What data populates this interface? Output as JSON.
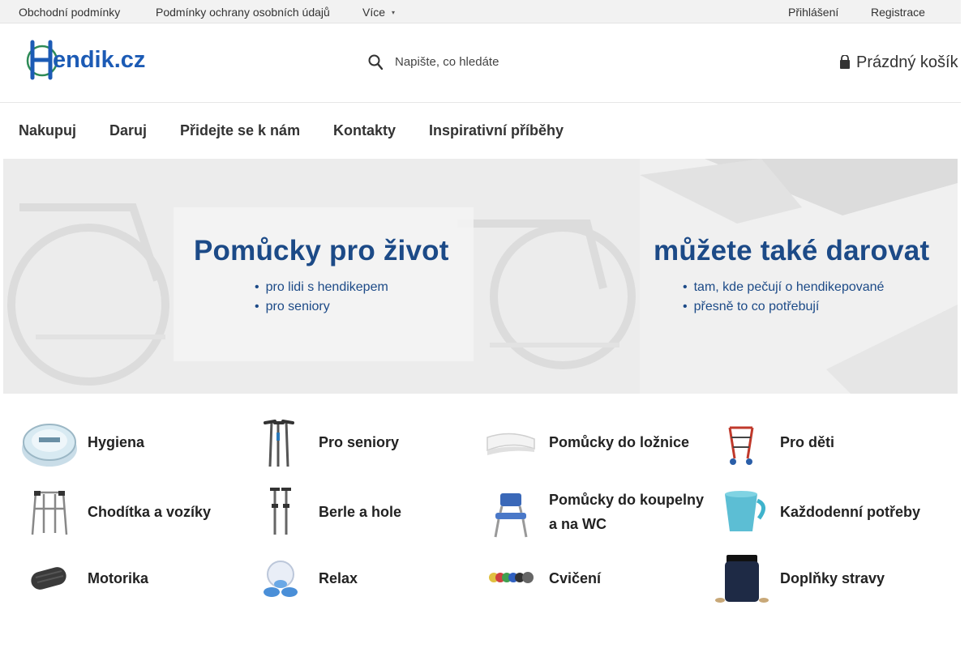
{
  "topbar": {
    "links": [
      "Obchodní podmínky",
      "Podmínky ochrany osobních údajů",
      "Více"
    ],
    "login": "Přihlášení",
    "register": "Registrace"
  },
  "header": {
    "logo_text": "Hendik.cz",
    "search_placeholder": "Napište, co hledáte",
    "cart_label": "Prázdný košík"
  },
  "nav": {
    "items": [
      "Nakupuj",
      "Daruj",
      "Přidejte se k nám",
      "Kontakty",
      "Inspirativní příběhy"
    ]
  },
  "banners": [
    {
      "title": "Pomůcky pro život",
      "bullets": [
        "pro lidi s hendikepem",
        "pro seniory"
      ]
    },
    {
      "title": "můžete také darovat",
      "bullets": [
        "tam, kde pečují o hendikepované",
        "přesně to co potřebují"
      ]
    }
  ],
  "brand_color": "#1c4a87",
  "categories": [
    {
      "name": "Hygiena",
      "icon": "cream-jar-icon"
    },
    {
      "name": "Pro seniory",
      "icon": "walking-canes-icon"
    },
    {
      "name": "Pomůcky do ložnice",
      "icon": "pillow-icon"
    },
    {
      "name": "Pro děti",
      "icon": "kids-walker-icon"
    },
    {
      "name": "Chodítka a vozíky",
      "icon": "walking-frame-icon"
    },
    {
      "name": "Berle a hole",
      "icon": "crutches-icon"
    },
    {
      "name": "Pomůcky do koupelny",
      "name_line2": "a na WC",
      "icon": "shower-chair-icon"
    },
    {
      "name": "Každodenní potřeby",
      "icon": "cup-icon"
    },
    {
      "name": "Motorika",
      "icon": "massage-roller-icon"
    },
    {
      "name": "Relax",
      "icon": "massager-icon"
    },
    {
      "name": "Cvičení",
      "icon": "exercise-bands-icon"
    },
    {
      "name": "Doplňky stravy",
      "icon": "supplement-jar-icon"
    }
  ]
}
